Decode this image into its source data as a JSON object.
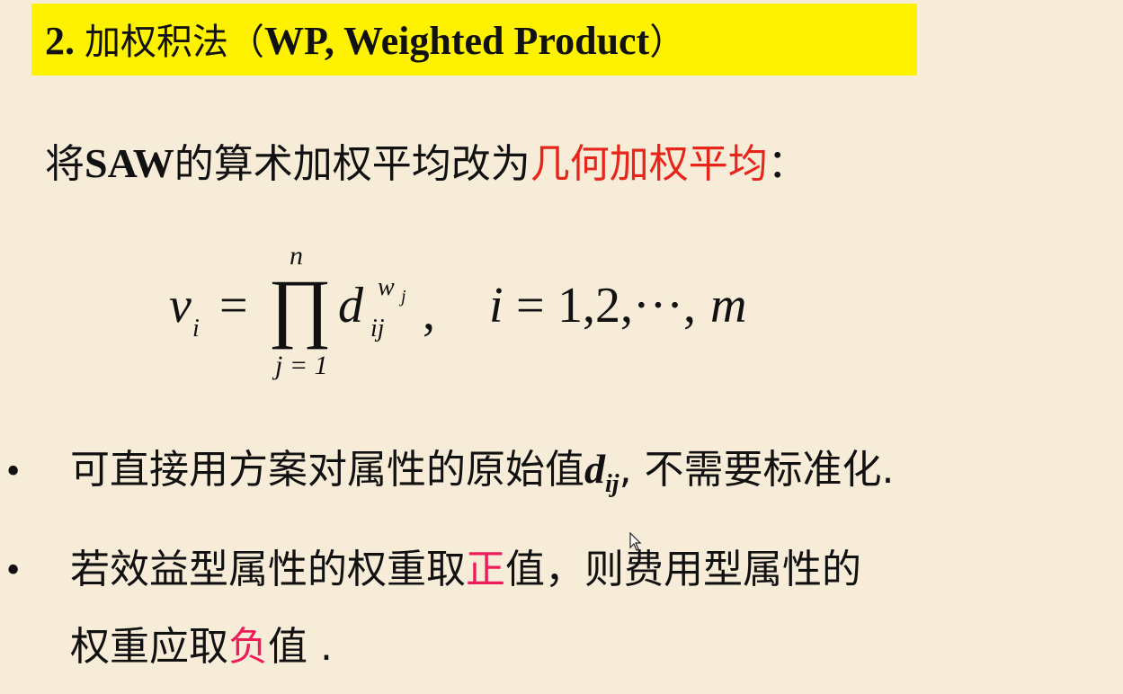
{
  "title": {
    "number": "2.",
    "cn": "加权积法",
    "open_paren": "（",
    "en": "WP, Weighted Product",
    "close_paren": "）"
  },
  "intro": {
    "pre": "将",
    "abbr": "SAW",
    "mid": "的算术加权平均改为",
    "highlight": "几何加权平均",
    "colon": "："
  },
  "formula": {
    "lhs_var": "v",
    "lhs_sub": "i",
    "equals": "=",
    "product_symbol": "∏",
    "upper_limit": "n",
    "lower_limit": "j = 1",
    "base": "d",
    "base_sub": "ij",
    "exponent": "w",
    "exponent_sub": "j",
    "comma": ",",
    "index_var": "i",
    "index_eq": "=",
    "index_range": "1,2,···,",
    "index_end": "m"
  },
  "bullets": [
    {
      "marker": "•",
      "pre": "可直接用方案对属性的原始值",
      "var": "d",
      "var_sub": "ij",
      "post": ", 不需要标准化."
    },
    {
      "marker": "•",
      "pre": "若效益型属性的权重取",
      "highlight": "正",
      "post": "值，则费用型属性的",
      "line2_pre": "权重应取",
      "line2_highlight": "负",
      "line2_post": "值 ."
    }
  ],
  "colors": {
    "background": "#f6ecd8",
    "title_bar": "#fff200",
    "red": "#e8251a",
    "pink": "#ee1d5a"
  }
}
